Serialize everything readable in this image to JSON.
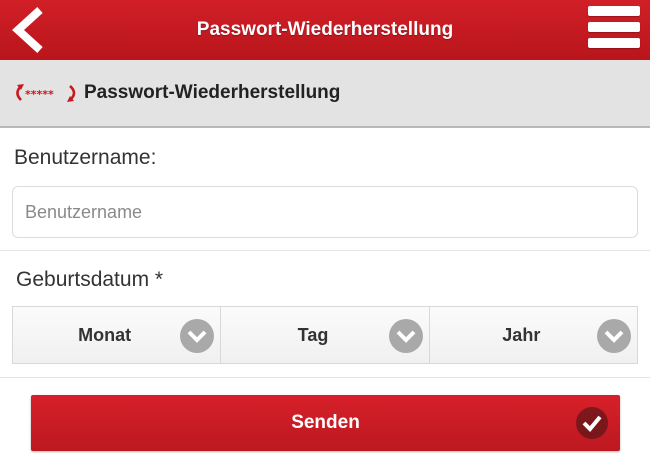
{
  "header": {
    "title": "Passwort-Wiederherstellung",
    "back_icon": "chevron-left-icon",
    "menu_icon": "hamburger-menu-icon"
  },
  "subheader": {
    "icon": "password-reset-icon",
    "title": "Passwort-Wiederherstellung"
  },
  "form": {
    "username_label": "Benutzername:",
    "username_placeholder": "Benutzername",
    "username_value": "",
    "birthdate_label": "Geburtsdatum *",
    "month_label": "Monat",
    "day_label": "Tag",
    "year_label": "Jahr",
    "submit_label": "Senden"
  },
  "colors": {
    "brand_red": "#c8191f",
    "subheader_bg": "#e3e3e3",
    "chevron_gray": "#a9a9a9"
  }
}
